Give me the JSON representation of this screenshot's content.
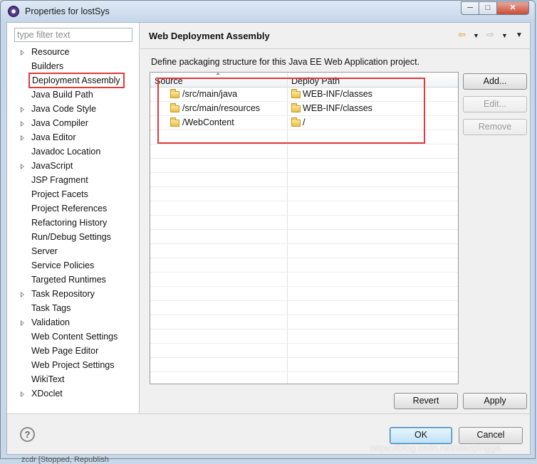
{
  "window": {
    "title": "Properties for lostSys",
    "controls": [
      "minimize",
      "maximize",
      "close"
    ]
  },
  "sidebar": {
    "filter_placeholder": "type filter text",
    "items": [
      {
        "label": "Resource",
        "expandable": true
      },
      {
        "label": "Builders",
        "expandable": false
      },
      {
        "label": "Deployment Assembly",
        "expandable": false,
        "selected": true
      },
      {
        "label": "Java Build Path",
        "expandable": false
      },
      {
        "label": "Java Code Style",
        "expandable": true
      },
      {
        "label": "Java Compiler",
        "expandable": true
      },
      {
        "label": "Java Editor",
        "expandable": true
      },
      {
        "label": "Javadoc Location",
        "expandable": false
      },
      {
        "label": "JavaScript",
        "expandable": true
      },
      {
        "label": "JSP Fragment",
        "expandable": false
      },
      {
        "label": "Project Facets",
        "expandable": false
      },
      {
        "label": "Project References",
        "expandable": false
      },
      {
        "label": "Refactoring History",
        "expandable": false
      },
      {
        "label": "Run/Debug Settings",
        "expandable": false
      },
      {
        "label": "Server",
        "expandable": false
      },
      {
        "label": "Service Policies",
        "expandable": false
      },
      {
        "label": "Targeted Runtimes",
        "expandable": false
      },
      {
        "label": "Task Repository",
        "expandable": true
      },
      {
        "label": "Task Tags",
        "expandable": false
      },
      {
        "label": "Validation",
        "expandable": true
      },
      {
        "label": "Web Content Settings",
        "expandable": false
      },
      {
        "label": "Web Page Editor",
        "expandable": false
      },
      {
        "label": "Web Project Settings",
        "expandable": false
      },
      {
        "label": "WikiText",
        "expandable": false
      },
      {
        "label": "XDoclet",
        "expandable": true
      }
    ]
  },
  "page": {
    "title": "Web Deployment Assembly",
    "description": "Define packaging structure for this Java EE Web Application project.",
    "nav_icons": [
      "back-arrow-icon",
      "dropdown-icon",
      "forward-arrow-icon",
      "dropdown-icon",
      "view-menu-icon"
    ],
    "table": {
      "columns": [
        "Source",
        "Deploy Path"
      ],
      "rows": [
        {
          "source": "/src/main/java",
          "deploy_path": "WEB-INF/classes"
        },
        {
          "source": "/src/main/resources",
          "deploy_path": "WEB-INF/classes"
        },
        {
          "source": "/WebContent",
          "deploy_path": "/"
        }
      ]
    },
    "buttons": {
      "add": "Add...",
      "edit": "Edit...",
      "remove": "Remove",
      "revert": "Revert",
      "apply": "Apply"
    }
  },
  "footer": {
    "ok": "OK",
    "cancel": "Cancel",
    "help_symbol": "?"
  },
  "background": {
    "behind_text": "zcdr  [Stopped, Republish"
  },
  "watermark": "https://blog.csdn.net/xiaopingga",
  "colors": {
    "highlight_border": "#e23a3a",
    "ok_button_border": "#3c7fb1"
  }
}
